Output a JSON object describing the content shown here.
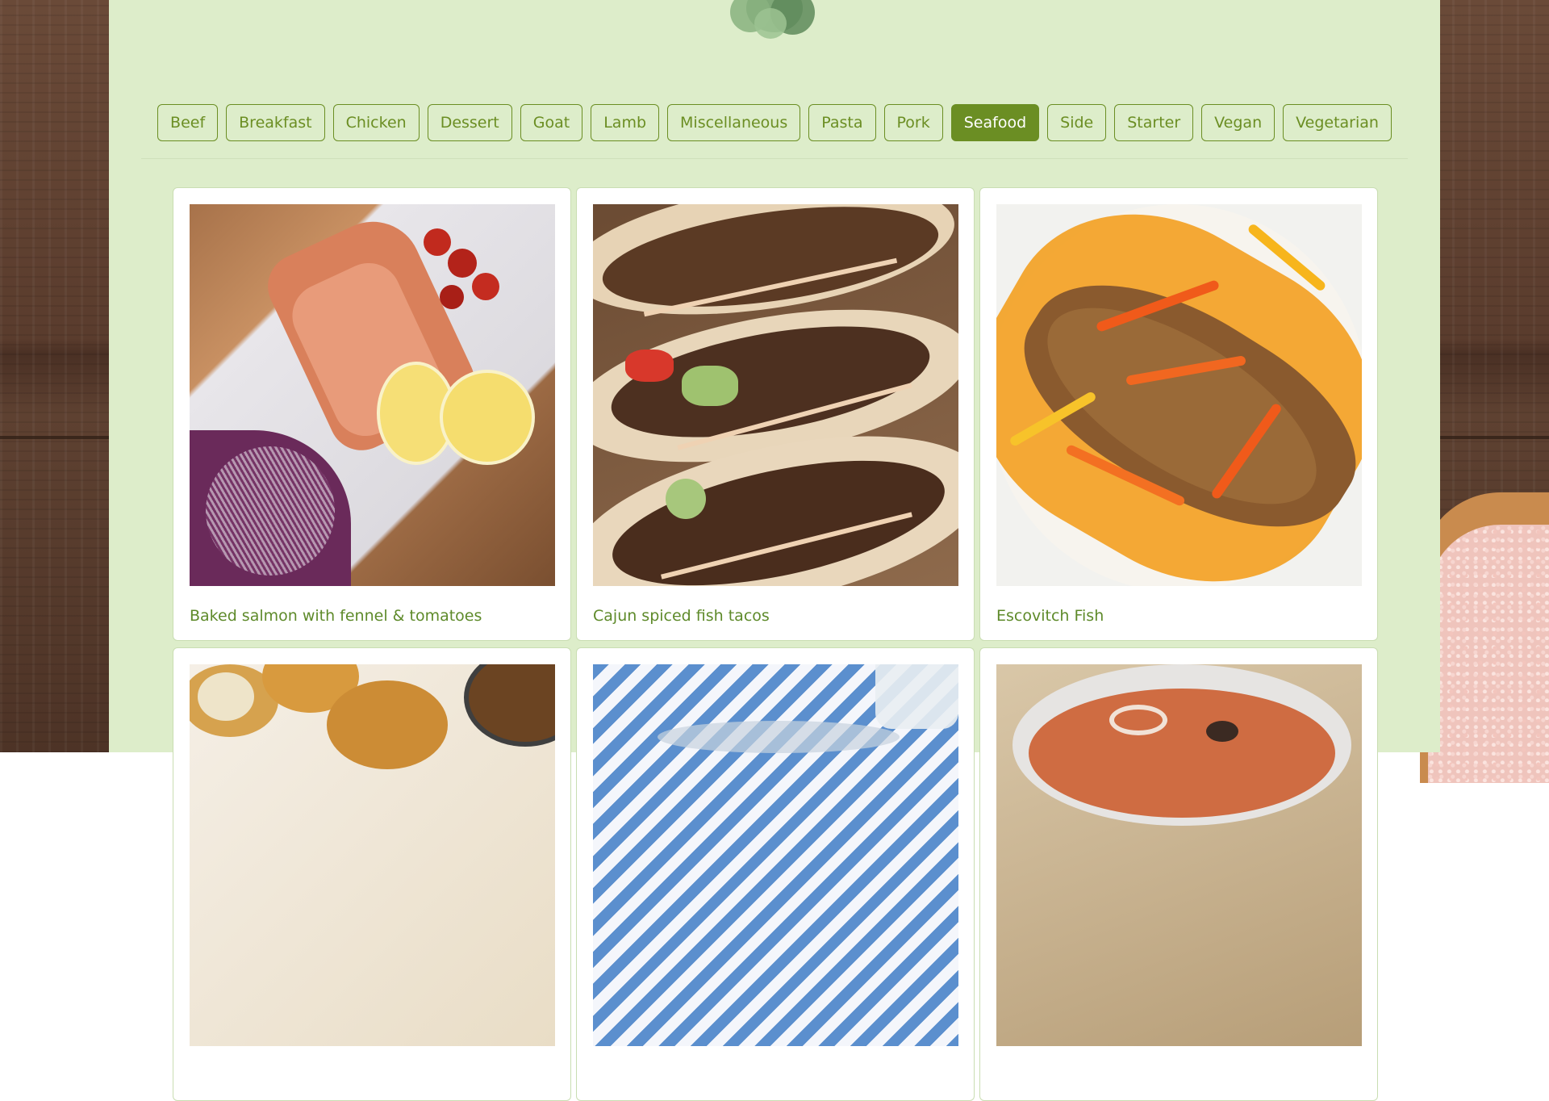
{
  "categories": {
    "items": [
      "Beef",
      "Breakfast",
      "Chicken",
      "Dessert",
      "Goat",
      "Lamb",
      "Miscellaneous",
      "Pasta",
      "Pork",
      "Seafood",
      "Side",
      "Starter",
      "Vegan",
      "Vegetarian"
    ],
    "active": "Seafood"
  },
  "meals": [
    {
      "name": "Baked salmon with fennel & tomatoes",
      "image": "baked-salmon-photo"
    },
    {
      "name": "Cajun spiced fish tacos",
      "image": "fish-tacos-photo"
    },
    {
      "name": "Escovitch Fish",
      "image": "escovitch-fish-photo"
    },
    {
      "name": "",
      "image": "fish-croquettes-photo"
    },
    {
      "name": "",
      "image": "striped-cloth-dish-photo"
    },
    {
      "name": "",
      "image": "seafood-soup-photo"
    }
  ],
  "colors": {
    "accent": "#6b8e23",
    "panel": "#ddedca",
    "card": "#ffffff",
    "title": "#5e8a2a"
  }
}
